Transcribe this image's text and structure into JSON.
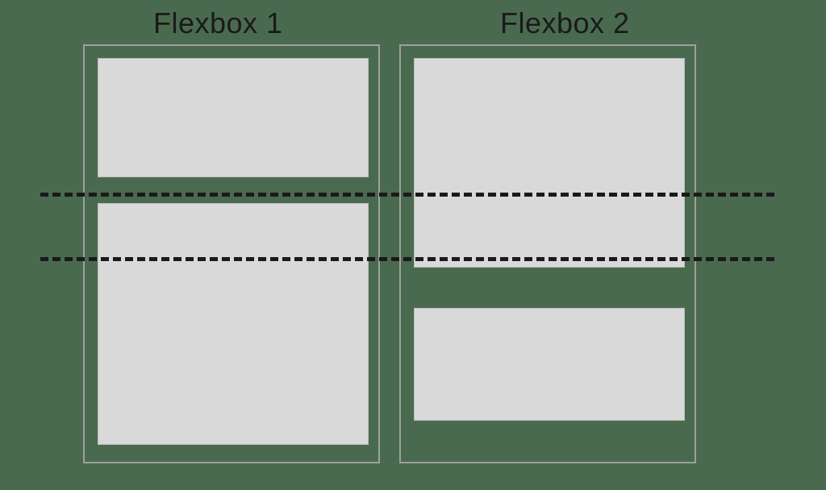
{
  "titles": {
    "flexbox1": "Flexbox 1",
    "flexbox2": "Flexbox 2"
  }
}
